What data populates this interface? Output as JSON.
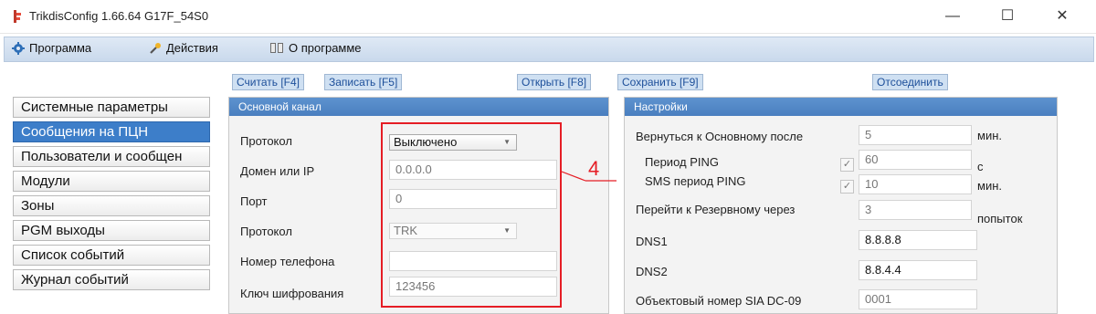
{
  "window": {
    "title": "TrikdisConfig 1.66.64   G17F_54S0",
    "controls": {
      "minimize": "—",
      "maximize": "☐",
      "close": "✕"
    }
  },
  "menu": [
    {
      "label": "Программа",
      "icon": "gear-icon"
    },
    {
      "label": "Действия",
      "icon": "wrench-icon"
    },
    {
      "label": "О программе",
      "icon": "book-icon"
    }
  ],
  "toolbar": {
    "read": "Считать [F4]",
    "write": "Записать [F5]",
    "open": "Открыть [F8]",
    "save": "Сохранить [F9]",
    "disconnect": "Отсоединить"
  },
  "sidebar": {
    "items": [
      {
        "label": "Системные параметры"
      },
      {
        "label": "Сообщения на ПЦН",
        "active": true
      },
      {
        "label": "Пользователи и сообщен"
      },
      {
        "label": "Модули"
      },
      {
        "label": "Зоны"
      },
      {
        "label": "PGM выходы"
      },
      {
        "label": "Список событий"
      },
      {
        "label": "Журнал событий"
      }
    ]
  },
  "main_channel": {
    "title": "Основной канал",
    "protocol1_label": "Протокол",
    "protocol1_value": "Выключено",
    "domain_label": "Домен или IP",
    "domain_value": "0.0.0.0",
    "port_label": "Порт",
    "port_value": "0",
    "protocol2_label": "Протокол",
    "protocol2_value": "TRK",
    "phone_label": "Номер телефона",
    "phone_value": "",
    "key_label": "Ключ шифрования",
    "key_value": "123456"
  },
  "settings": {
    "title": "Настройки",
    "return_label": "Вернуться к Основному после",
    "return_value": "5",
    "return_unit": "мин.",
    "ping_label": "Период PING",
    "ping_value": "60",
    "ping_unit": "с",
    "ping_checked": true,
    "sms_ping_label": "SMS период PING",
    "sms_ping_value": "10",
    "sms_ping_unit": "мин.",
    "sms_ping_checked": true,
    "backup_label": "Перейти к Резервному через",
    "backup_value": "3",
    "backup_unit": "попыток",
    "dns1_label": "DNS1",
    "dns1_value": "8.8.8.8",
    "dns2_label": "DNS2",
    "dns2_value": "8.8.4.4",
    "sia_label": "Объектовый номер SIA DC-09",
    "sia_value": "0001"
  },
  "annotation": {
    "number": "4",
    "color": "#e51d25"
  },
  "colors": {
    "accent": "#3d7ec9",
    "panel_header": "#4a7fbf",
    "toolbar_text": "#1d4f9a"
  }
}
